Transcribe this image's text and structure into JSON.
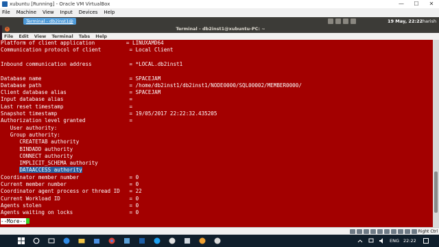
{
  "vbox": {
    "title": "xubuntu [Running] - Oracle VM VirtualBox",
    "menu": [
      "File",
      "Machine",
      "View",
      "Input",
      "Devices",
      "Help"
    ],
    "controls": [
      "—",
      "☐",
      "✕"
    ]
  },
  "panel": {
    "active_tab": "Terminal - db2inst1@",
    "date": "19 May, 22:22",
    "user": "harish"
  },
  "terminal": {
    "title": "Terminal - db2inst1@xubuntu-PC: ~",
    "menu": [
      "File",
      "Edit",
      "View",
      "Terminal",
      "Tabs",
      "Help"
    ],
    "lines": [
      "Platform of client application          = LINUXAMD64",
      "Communication protocol of client         = Local Client",
      "",
      "Inbound communication address            = *LOCAL.db2inst1",
      "",
      "Database name                            = SPACEJAM",
      "Database path                            = /home/db2inst1/db2inst1/NODE0000/SQL00002/MEMBER0000/",
      "Client database alias                    = SPACEJAM",
      "Input database alias                     =",
      "Last reset timestamp                     =",
      "Snapshot timestamp                       = 19/05/2017 22:22:32.435205",
      "Authorization level granted              =",
      "   User authority:",
      "   Group authority:",
      "      CREATETAB authority",
      "      BINDADD authority",
      "      CONNECT authority",
      "      IMPLICIT_SCHEMA authority",
      "      DATAACCESS authority",
      "Coordinator member number                = 0",
      "Current member number                    = 0",
      "Coordinator agent process or thread ID   = 22",
      "Current Workload ID                      = 0",
      "Agents stolen                            = 0",
      "Agents waiting on locks                  = 0"
    ],
    "highlight_text": "DATAACCESS authority",
    "more_prompt": "--More--"
  },
  "status": {
    "host_key": "Right Ctrl"
  },
  "taskbar": {
    "lang": "ENG",
    "time": "22:22"
  },
  "colors": {
    "terminal_bg": "#a30000",
    "terminal_fg": "#ffffff",
    "selection": "#2d5f9e",
    "cursor": "#34d826",
    "taskbar": "#101f2c"
  }
}
